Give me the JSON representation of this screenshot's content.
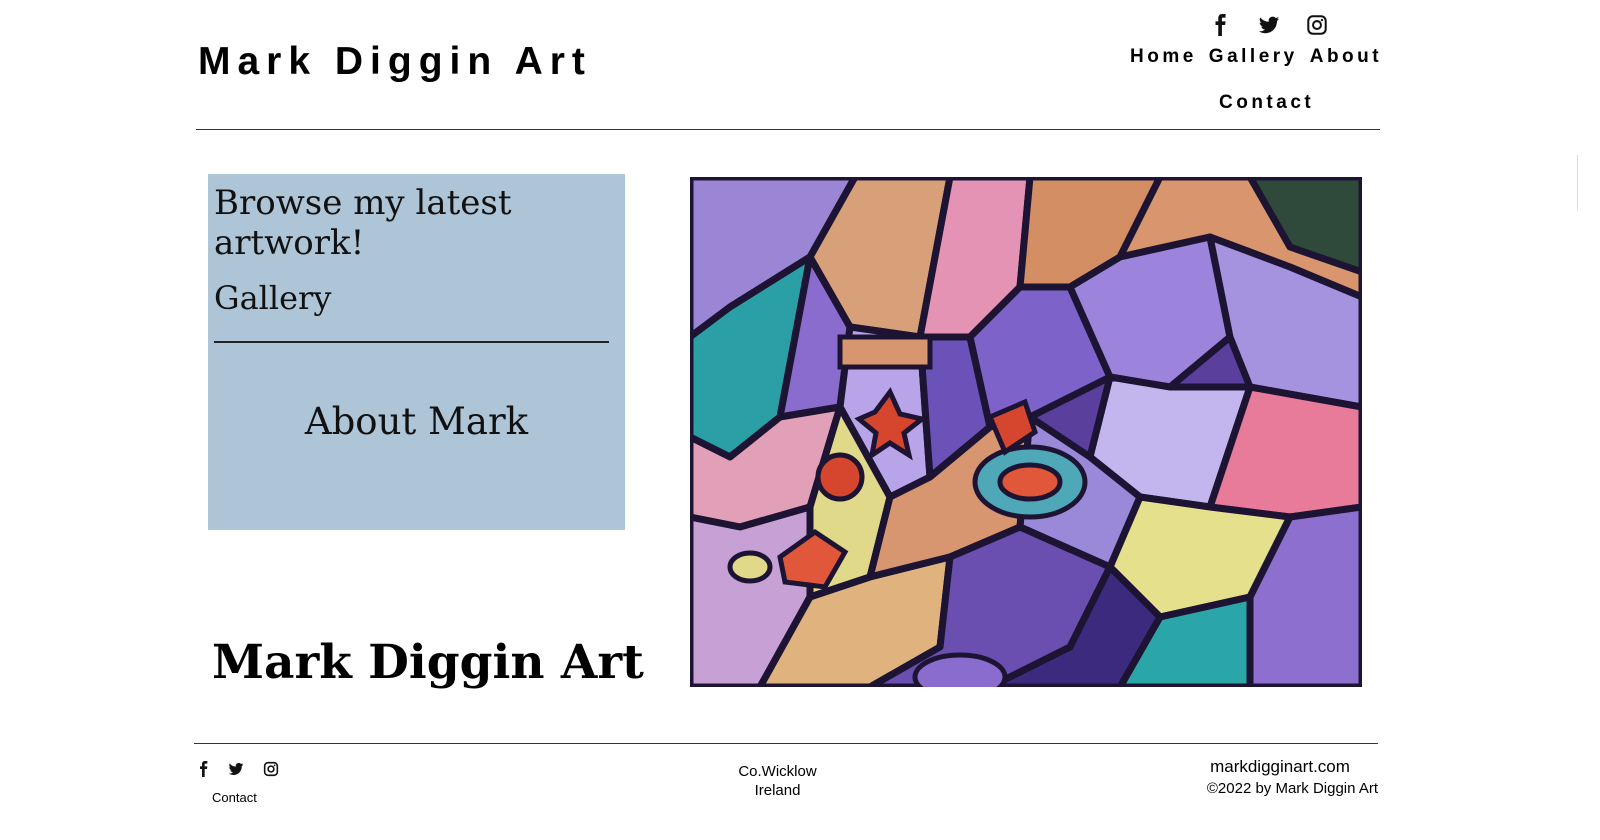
{
  "header": {
    "site_title": "Mark Diggin Art",
    "social": [
      {
        "icon": "facebook-icon"
      },
      {
        "icon": "twitter-icon"
      },
      {
        "icon": "instagram-icon"
      }
    ],
    "nav": [
      "Home",
      "Gallery",
      "About",
      "Contact"
    ]
  },
  "panel": {
    "heading": "Browse my latest artwork!",
    "gallery_link": "Gallery",
    "about_link": "About Mark",
    "background": "#adc5d7"
  },
  "main": {
    "big_title": "Mark Diggin Art",
    "artwork_alt": ""
  },
  "footer": {
    "social": [
      {
        "icon": "facebook-icon"
      },
      {
        "icon": "twitter-icon"
      },
      {
        "icon": "instagram-icon"
      }
    ],
    "contact_link": "Contact",
    "location_line1": "Co.Wicklow",
    "location_line2": "Ireland",
    "website": "markdigginart.com",
    "copyright": "©2022 by Mark Diggin Art"
  }
}
